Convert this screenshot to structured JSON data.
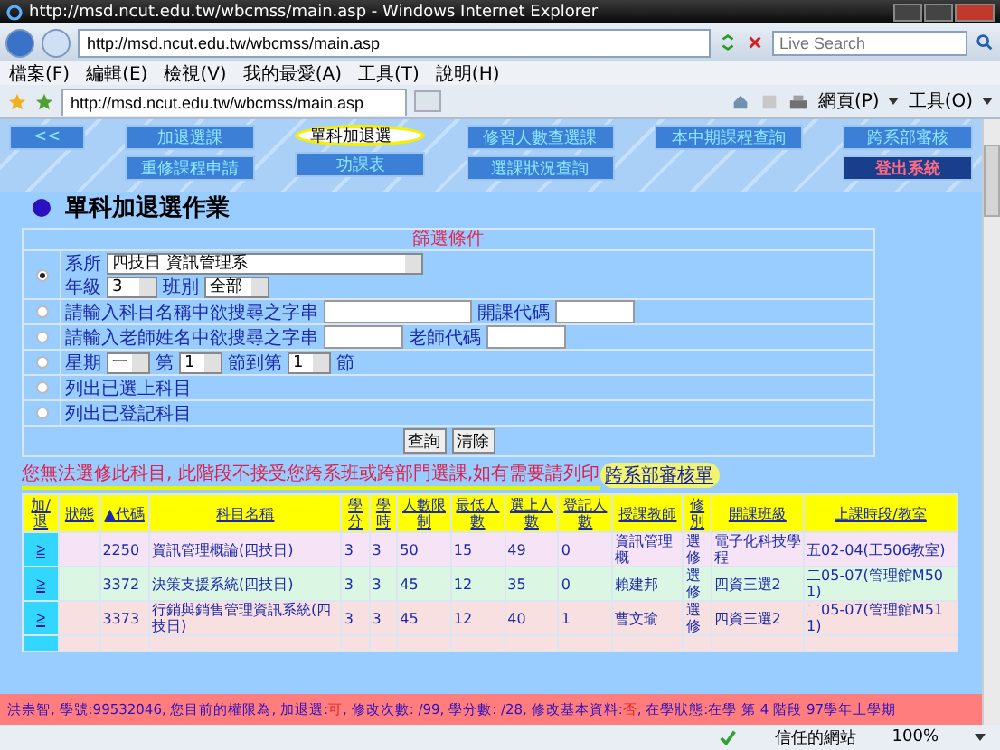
{
  "window": {
    "title": "http://msd.ncut.edu.tw/wbcmss/main.asp - Windows Internet Explorer"
  },
  "address_bar": {
    "url": "http://msd.ncut.edu.tw/wbcmss/main.asp",
    "search_placeholder": "Live Search"
  },
  "menu": [
    "檔案(F)",
    "編輯(E)",
    "檢視(V)",
    "我的最愛(A)",
    "工具(T)",
    "說明(H)"
  ],
  "tab": {
    "title": "http://msd.ncut.edu.tw/wbcmss/main.asp"
  },
  "command_bar": [
    "網頁(P)",
    "工具(O)"
  ],
  "nav_columns": [
    [
      {
        "label": "<<",
        "selected": false,
        "kind": "normal"
      }
    ],
    [
      {
        "label": "加退選課",
        "selected": false,
        "kind": "normal"
      },
      {
        "label": "重修課程申請",
        "selected": false,
        "kind": "normal"
      }
    ],
    [
      {
        "label": "單科加退選",
        "selected": true,
        "kind": "normal"
      },
      {
        "label": "功課表",
        "selected": false,
        "kind": "normal"
      }
    ],
    [
      {
        "label": "修習人數查選課",
        "selected": false,
        "kind": "normal"
      },
      {
        "label": "選課狀況查詢",
        "selected": false,
        "kind": "normal"
      }
    ],
    [
      {
        "label": "本中期課程查詢",
        "selected": false,
        "kind": "normal"
      }
    ],
    [
      {
        "label": "跨系部審核",
        "selected": false,
        "kind": "normal"
      },
      {
        "label": "登出系統",
        "selected": false,
        "kind": "logout"
      }
    ]
  ],
  "heading": "單科加退選作業",
  "filter": {
    "title": "篩選條件",
    "options": [
      {
        "kind": "dept",
        "selected": true,
        "dept_label": "系所",
        "dept_value": "四技日 資訊管理系",
        "grade_label": "年級",
        "grade_value": "3",
        "class_label": "班別",
        "class_value": "全部"
      },
      {
        "kind": "search",
        "selected": false,
        "label": "請輸入科目名稱中欲搜尋之字串",
        "code_label": "開課代碼"
      },
      {
        "kind": "search",
        "selected": false,
        "label": "請輸入老師姓名中欲搜尋之字串",
        "code_label": "老師代碼"
      },
      {
        "kind": "time",
        "selected": false,
        "day_label": "星期",
        "day_value": "一",
        "from_label": "第",
        "from_value": "1",
        "to_label": "節到第",
        "to_value": "1",
        "end_label": "節"
      },
      {
        "kind": "list",
        "selected": false,
        "label": "列出已選上科目"
      },
      {
        "kind": "list",
        "selected": false,
        "label": "列出已登記科目"
      }
    ],
    "buttons": [
      "查詢",
      "清除"
    ]
  },
  "error": {
    "text": "您無法選修此科目, 此階段不接受您跨系班或跨部門選課,如有需要請列印",
    "link": "跨系部審核單",
    "highlighted": true
  },
  "table": {
    "columns": [
      "加/退",
      "狀態",
      "▲代碼",
      "科目名稱",
      "學分",
      "學時",
      "人數限制",
      "最低人數",
      "選上人數",
      "登記人數",
      "授課教師",
      "修別",
      "開課班級",
      "上課時段/教室"
    ],
    "rows": [
      {
        "color": "#f6e4f6",
        "cells": [
          "≥",
          "",
          "2250",
          "資訊管理概論(四技日)",
          "3",
          "3",
          "50",
          "15",
          "49",
          "0",
          "資訊管理概",
          "選修",
          "電子化科技學程",
          "五02-04(工506教室)"
        ]
      },
      {
        "color": "#dcf6e4",
        "cells": [
          "≥",
          "",
          "3372",
          "決策支援系統(四技日)",
          "3",
          "3",
          "45",
          "12",
          "35",
          "0",
          "賴建邦",
          "選修",
          "四資三選2",
          "二05-07(管理館M501)"
        ]
      },
      {
        "color": "#f8dfe0",
        "cells": [
          "≥",
          "",
          "3373",
          "行銷與銷售管理資訊系統(四技日)",
          "3",
          "3",
          "45",
          "12",
          "40",
          "1",
          "曹文瑜",
          "選修",
          "四資三選2",
          "二05-07(管理館M511)"
        ]
      }
    ]
  },
  "student_info": [
    {
      "kind": "label",
      "text": "洪崇智, 學號:99532046, 您目前的權限為, 加退選:"
    },
    {
      "kind": "value",
      "text": "可"
    },
    {
      "kind": "label",
      "text": ", 修改次數: /99, 學分數: /28, 修改基本資料:"
    },
    {
      "kind": "value",
      "text": "否"
    },
    {
      "kind": "label",
      "text": ", 在學狀態:在學 第 4 階段 97學年上學期"
    }
  ],
  "status_bar": {
    "zone": "信任的網站",
    "zoom": "100%"
  }
}
